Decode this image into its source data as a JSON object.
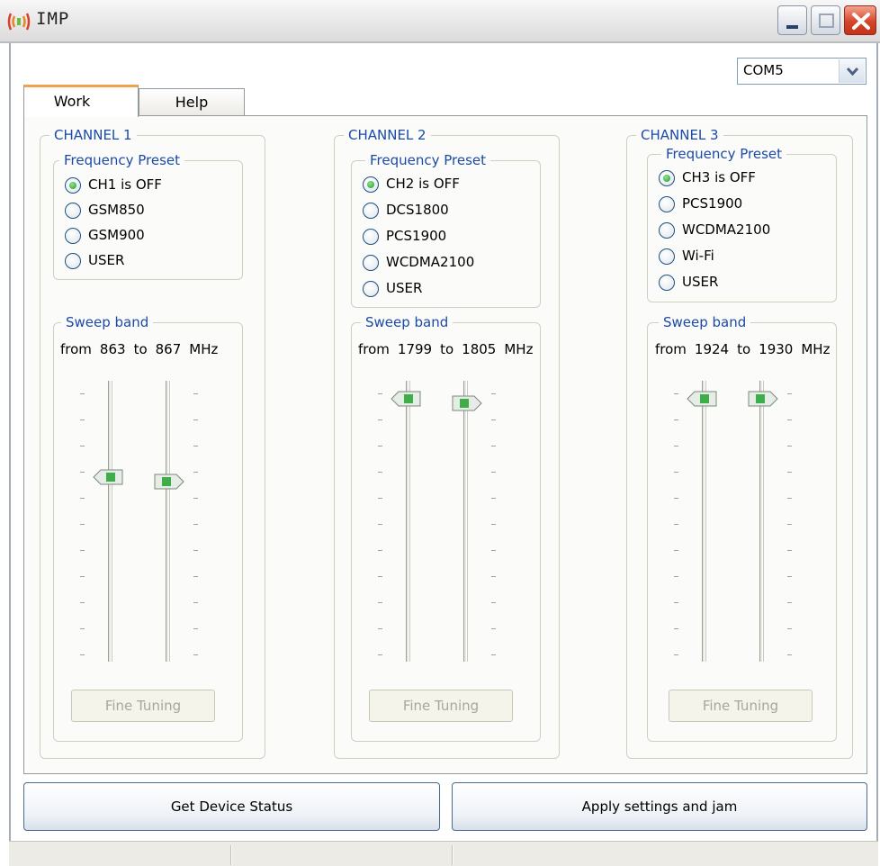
{
  "window": {
    "title": "IMP"
  },
  "com_port": {
    "selected": "COM5"
  },
  "tabs": [
    {
      "label": "Work",
      "active": true
    },
    {
      "label": "Help",
      "active": false
    }
  ],
  "channels": [
    {
      "title": "CHANNEL 1",
      "preset_title": "Frequency Preset",
      "presets": [
        {
          "label": "CH1 is OFF",
          "checked": true
        },
        {
          "label": "GSM850",
          "checked": false
        },
        {
          "label": "GSM900",
          "checked": false
        },
        {
          "label": "USER",
          "checked": false
        }
      ],
      "sweep_title": "Sweep band",
      "sweep": {
        "from_word": "from",
        "from": "863",
        "to_word": "to",
        "to": "867",
        "unit": "MHz"
      },
      "sweep_levels": {
        "low": 0.68,
        "high": 0.66
      },
      "fine_tuning": "Fine Tuning"
    },
    {
      "title": "CHANNEL 2",
      "preset_title": "Frequency Preset",
      "presets": [
        {
          "label": "CH2 is OFF",
          "checked": true
        },
        {
          "label": "DCS1800",
          "checked": false
        },
        {
          "label": "PCS1900",
          "checked": false
        },
        {
          "label": "WCDMA2100",
          "checked": false
        },
        {
          "label": "USER",
          "checked": false
        }
      ],
      "sweep_title": "Sweep band",
      "sweep": {
        "from_word": "from",
        "from": "1799",
        "to_word": "to",
        "to": "1805",
        "unit": "MHz"
      },
      "sweep_levels": {
        "low": 1.0,
        "high": 0.98
      },
      "fine_tuning": "Fine Tuning"
    },
    {
      "title": "CHANNEL 3",
      "preset_title": "Frequency Preset",
      "presets": [
        {
          "label": "CH3 is OFF",
          "checked": true
        },
        {
          "label": "PCS1900",
          "checked": false
        },
        {
          "label": "WCDMA2100",
          "checked": false
        },
        {
          "label": "Wi-Fi",
          "checked": false
        },
        {
          "label": "USER",
          "checked": false
        }
      ],
      "sweep_title": "Sweep band",
      "sweep": {
        "from_word": "from",
        "from": "1924",
        "to_word": "to",
        "to": "1930",
        "unit": "MHz"
      },
      "sweep_levels": {
        "low": 1.0,
        "high": 1.0
      },
      "fine_tuning": "Fine Tuning"
    }
  ],
  "buttons": {
    "status": "Get Device Status",
    "apply": "Apply settings and jam"
  },
  "colors": {
    "accent_tab": "#f0a34a",
    "legend_text": "#1b4aa8",
    "radio_dot": "#1f9b2a",
    "thumb": "#3fae4a",
    "close_button": "#d5452a"
  }
}
